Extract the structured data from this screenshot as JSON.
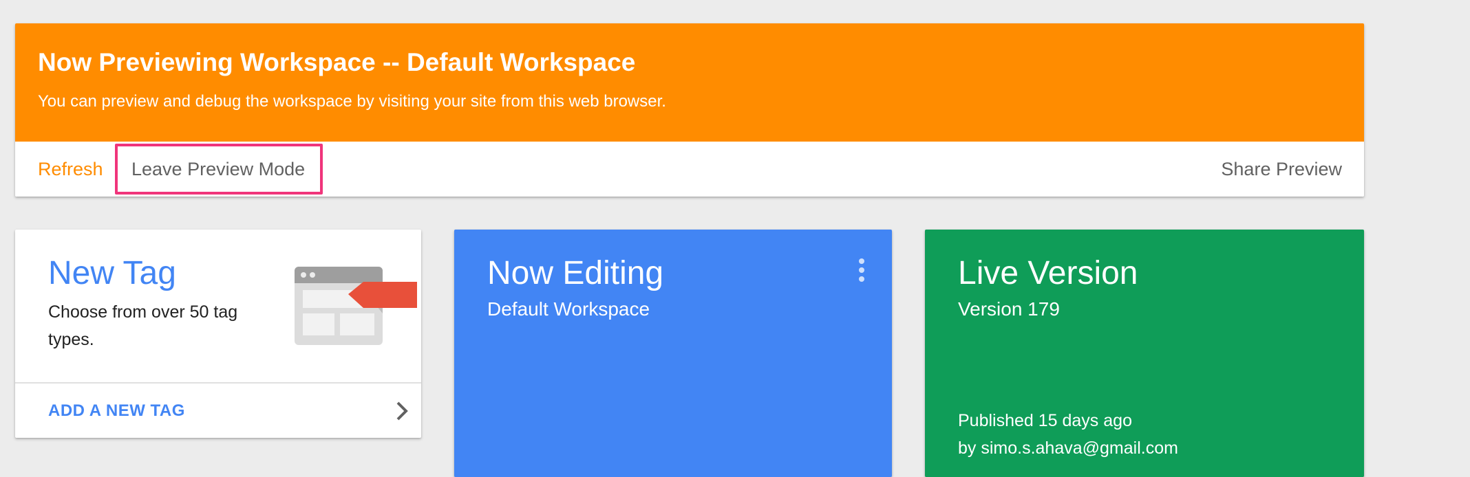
{
  "preview_banner": {
    "title": "Now Previewing Workspace -- Default Workspace",
    "subtitle": "You can preview and debug the workspace by visiting your site from this web browser.",
    "actions": {
      "refresh": "Refresh",
      "leave": "Leave Preview Mode",
      "share": "Share Preview"
    },
    "colors": {
      "header_bg": "#ff8c00",
      "highlight_border": "#f0357b"
    }
  },
  "new_tag_card": {
    "title": "New Tag",
    "description": "Choose from over 50 tag types.",
    "link_label": "ADD A NEW TAG",
    "illustration_icon": "tag-browser-illustration",
    "chevron_icon": "chevron-right-icon"
  },
  "now_editing_card": {
    "title": "Now Editing",
    "subtitle": "Default Workspace",
    "menu_icon": "more-vert-icon",
    "color": "#4285f4"
  },
  "live_version_card": {
    "title": "Live Version",
    "subtitle": "Version 179",
    "published": "Published 15 days ago",
    "published_by": "by simo.s.ahava@gmail.com",
    "color": "#0f9d58"
  }
}
